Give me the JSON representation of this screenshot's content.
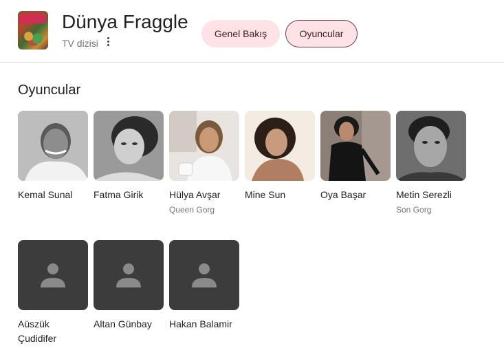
{
  "header": {
    "title": "Dünya Fraggle",
    "subtitle": "TV dizisi",
    "tabs": [
      {
        "label": "Genel Bakış"
      },
      {
        "label": "Oyuncular"
      }
    ]
  },
  "section": {
    "title": "Oyuncular"
  },
  "cast": [
    {
      "name": "Kemal Sunal",
      "role": ""
    },
    {
      "name": "Fatma Girik",
      "role": ""
    },
    {
      "name": "Hülya Avşar",
      "role": "Queen Gorg"
    },
    {
      "name": "Mine Sun",
      "role": ""
    },
    {
      "name": "Oya Başar",
      "role": ""
    },
    {
      "name": "Metin Serezli",
      "role": "Son Gorg"
    },
    {
      "name": "Aüszük Çudidifer",
      "role": ""
    },
    {
      "name": "Altan Günbay",
      "role": ""
    },
    {
      "name": "Hakan Balamir",
      "role": ""
    }
  ],
  "colors": {
    "chip_bg": "#fde2e6",
    "chip_border": "#6f3d45",
    "placeholder_bg": "#3c3c3c"
  }
}
